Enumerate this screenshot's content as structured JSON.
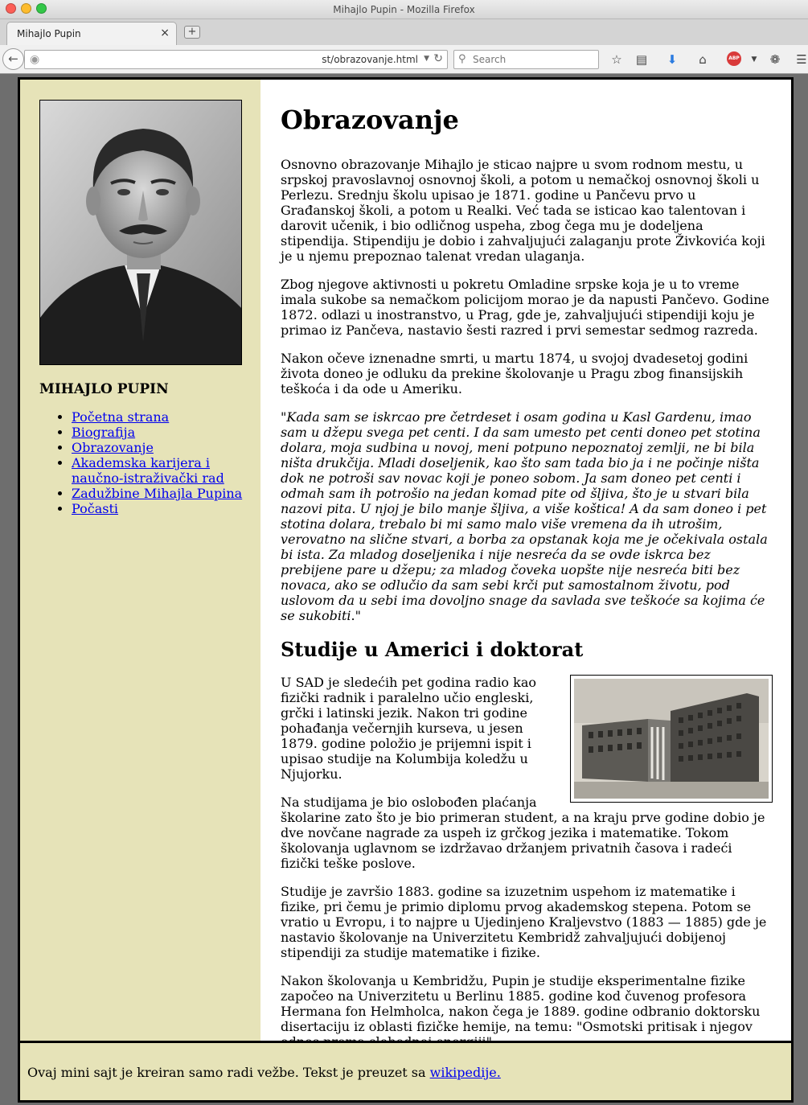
{
  "window": {
    "title": "Mihajlo Pupin - Mozilla Firefox"
  },
  "tab": {
    "title": "Mihajlo Pupin",
    "close": "×",
    "newtab": "+"
  },
  "navbar": {
    "url": "st/obrazovanje.html",
    "search_placeholder": "Search",
    "icons": [
      "back-arrow-icon",
      "globe-icon",
      "reload-icon",
      "search-icon",
      "star-icon",
      "reading-list-icon",
      "download-icon",
      "home-icon",
      "adblock-icon",
      "extension-icon",
      "menu-icon"
    ],
    "abp_label": "ABP"
  },
  "sidebar": {
    "name": "MIHAJLO PUPIN",
    "nav": [
      {
        "label": "Početna strana"
      },
      {
        "label": "Biografija"
      },
      {
        "label": "Obrazovanje"
      },
      {
        "label": "Akademska karijera i naučno-istraživački rad"
      },
      {
        "label": "Zadužbine Mihajla Pupina"
      },
      {
        "label": "Počasti"
      }
    ]
  },
  "content": {
    "title": "Obrazovanje",
    "p1": "Osnovno obrazovanje Mihajlo je sticao najpre u svom rodnom mestu, u srpskoj pravoslavnoj osnovnoj školi, a potom u nemačkoj osnovnoj školi u Perlezu. Srednju školu upisao je 1871. godine u Pančevu prvo u Građanskoj školi, a potom u Realki. Već tada se isticao kao talentovan i darovit učenik, i bio odličnog uspeha, zbog čega mu je dodeljena stipendija. Stipendiju je dobio i zahvaljujući zalaganju prote Živkovića koji je u njemu prepoznao talenat vredan ulaganja.",
    "p2": "Zbog njegove aktivnosti u pokretu Omladine srpske koja je u to vreme imala sukobe sa nemačkom policijom morao je da napusti Pančevo. Godine 1872. odlazi u inostranstvo, u Prag, gde je, zahvaljujući stipendiji koju je primao iz Pančeva, nastavio šesti razred i prvi semestar sedmog razreda.",
    "p3": "Nakon očeve iznenadne smrti, u martu 1874, u svojoj dvadesetoj godini života doneo je odluku da prekine školovanje u Pragu zbog finansijskih teškoća i da ode u Ameriku.",
    "quote_open": "\"",
    "quote": "Kada sam se iskrcao pre četrdeset i osam godina u Kasl Gardenu, imao sam u džepu svega pet centi. I da sam umesto pet centi doneo pet stotina dolara, moja sudbina u novoj, meni potpuno nepoznatoj zemlji, ne bi bila ništa drukčija. Mladi doseljenik, kao što sam tada bio ja i ne počinje ništa dok ne potroši sav novac koji je poneo sobom. Ja sam doneo pet centi i odmah sam ih potrošio na jedan komad pite od šljiva, što je u stvari bila nazovi pita. U njoj je bilo manje šljiva, a više koštica! A da sam doneo i pet stotina dolara, trebalo bi mi samo malo više vremena da ih utrošim, verovatno na slične stvari, a borba za opstanak koja me je očekivala ostala bi ista. Za mladog doseljenika i nije nesreća da se ovde iskrca bez prebijene pare u džepu; za mladog čoveka uopšte nije nesreća biti bez novaca, ako se odlučio da sam sebi krči put samostalnom životu, pod uslovom da u sebi ima dovoljno snage da savlada sve teškoće sa kojima će se sukobiti",
    "quote_close": ".\"",
    "subtitle": "Studije u Americi i doktorat",
    "p4": "U SAD je sledećih pet godina radio kao fizički radnik i paralelno učio engleski, grčki i latinski jezik. Nakon tri godine pohađanja večernjih kurseva, u jesen 1879. godine položio je prijemni ispit i upisao studije na Kolumbija koledžu u Njujorku.",
    "p5": "Na studijama je bio oslobođen plaćanja školarine zato što je bio primeran student, a na kraju prve godine dobio je dve novčane nagrade za uspeh iz grčkog jezika i matematike. Tokom školovanja uglavnom se izdržavao držanjem privatnih časova i radeći fizički teške poslove.",
    "p6": "Studije je završio 1883. godine sa izuzetnim uspehom iz matematike i fizike, pri čemu je primio diplomu prvog akademskog stepena. Potom se vratio u Evropu, i to najpre u Ujedinjeno Kraljevstvo (1883 — 1885) gde je nastavio školovanje na Univerzitetu Kembridž zahvaljujući dobijenoj stipendiji za studije matematike i fizike.",
    "p7": "Nakon školovanja u Kembridžu, Pupin je studije eksperimentalne fizike započeo na Univerzitetu u Berlinu 1885. godine kod čuvenog profesora Hermana fon Helmholca, nakon čega je 1889. godine odbranio doktorsku disertaciju iz oblasti fizičke hemije, na temu: \"Osmotski pritisak i njegov odnos prema slobodnoj energiji\"."
  },
  "footer": {
    "text": "Ovaj mini sajt je kreiran samo radi vežbe. Tekst je preuzet sa ",
    "link": "wikipedije."
  },
  "colors": {
    "sidebar_bg": "#e6e3b8",
    "link": "#0000ee",
    "border": "#000000"
  }
}
